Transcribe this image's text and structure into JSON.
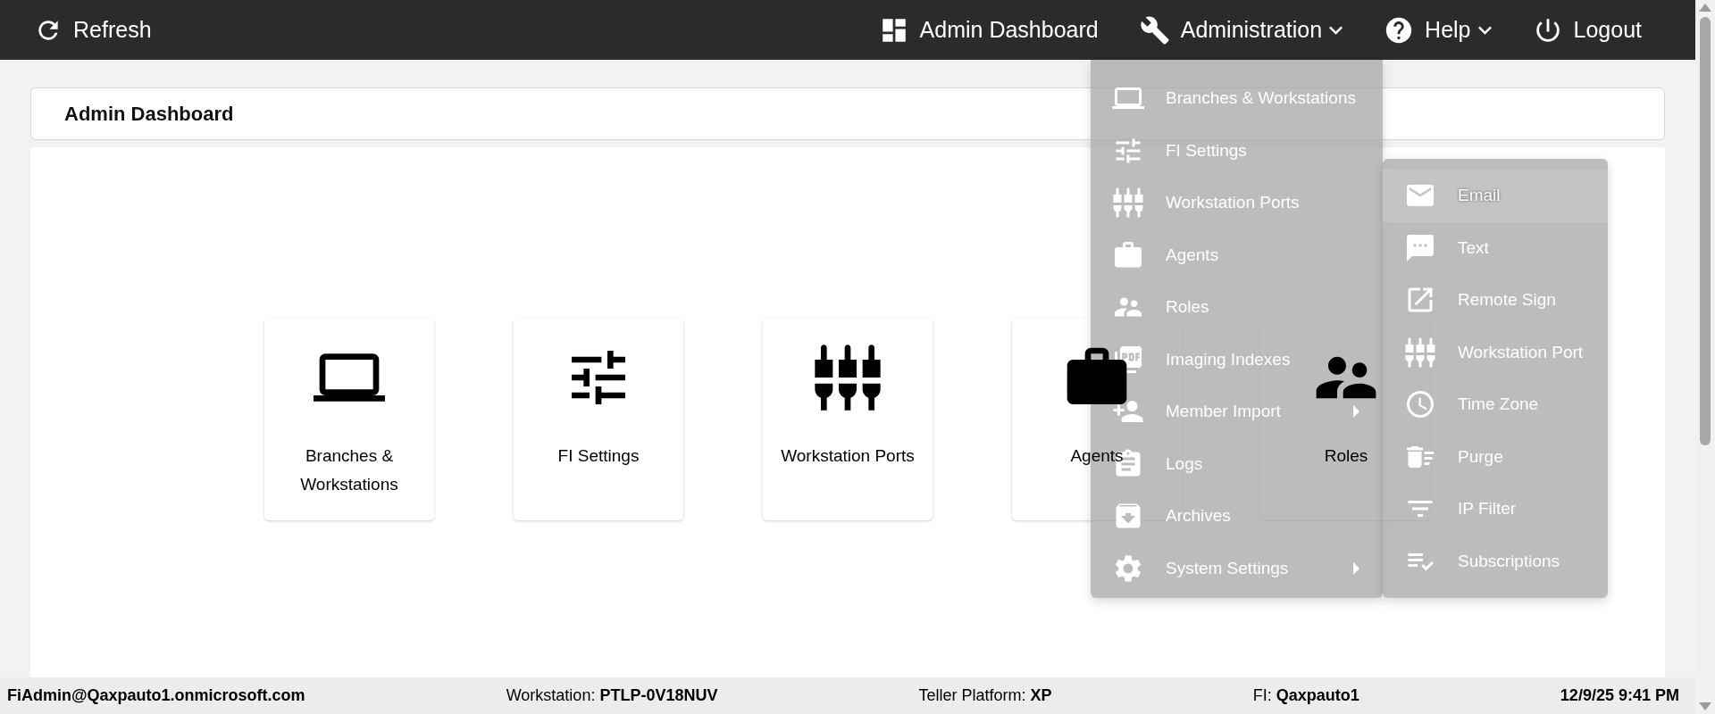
{
  "top_bar": {
    "left": {
      "label": "Refresh"
    },
    "items": [
      {
        "label": "Admin Dashboard",
        "kind": "link"
      },
      {
        "label": "Administration",
        "kind": "dropdown"
      },
      {
        "label": "Help",
        "kind": "dropdown"
      },
      {
        "label": "Logout",
        "kind": "link"
      }
    ]
  },
  "page_header": {
    "title": "Admin Dashboard"
  },
  "tiles": [
    {
      "label": "Branches & Workstations"
    },
    {
      "label": "FI Settings"
    },
    {
      "label": "Workstation Ports"
    },
    {
      "label": "Agents"
    },
    {
      "label": "Roles"
    }
  ],
  "admin_menu": {
    "items": [
      {
        "label": "Branches & Workstations",
        "kind": "item"
      },
      {
        "label": "FI Settings",
        "kind": "item"
      },
      {
        "label": "Workstation Ports",
        "kind": "item"
      },
      {
        "label": "Agents",
        "kind": "item"
      },
      {
        "label": "Roles",
        "kind": "item"
      },
      {
        "label": "Imaging Indexes",
        "kind": "item"
      },
      {
        "label": "Member Import",
        "kind": "submenu"
      },
      {
        "label": "Logs",
        "kind": "item"
      },
      {
        "label": "Archives",
        "kind": "item"
      },
      {
        "label": "System Settings",
        "kind": "submenu"
      }
    ]
  },
  "system_settings_menu": {
    "items": [
      {
        "label": "Email",
        "selected": true
      },
      {
        "label": "Text",
        "selected": false
      },
      {
        "label": "Remote Sign",
        "selected": false
      },
      {
        "label": "Workstation Port",
        "selected": false
      },
      {
        "label": "Time Zone",
        "selected": false
      },
      {
        "label": "Purge",
        "selected": false
      },
      {
        "label": "IP Filter",
        "selected": false
      },
      {
        "label": "Subscriptions",
        "selected": false
      }
    ]
  },
  "status_bar": {
    "user": "FiAdmin@Qaxpauto1.onmicrosoft.com",
    "fields": [
      {
        "label": "Workstation:",
        "value": "PTLP-0V18NUV"
      },
      {
        "label": "Teller Platform:",
        "value": "XP"
      },
      {
        "label": "FI:",
        "value": "Qaxpauto1"
      }
    ],
    "datetime": "12/9/25 9:41 PM"
  }
}
